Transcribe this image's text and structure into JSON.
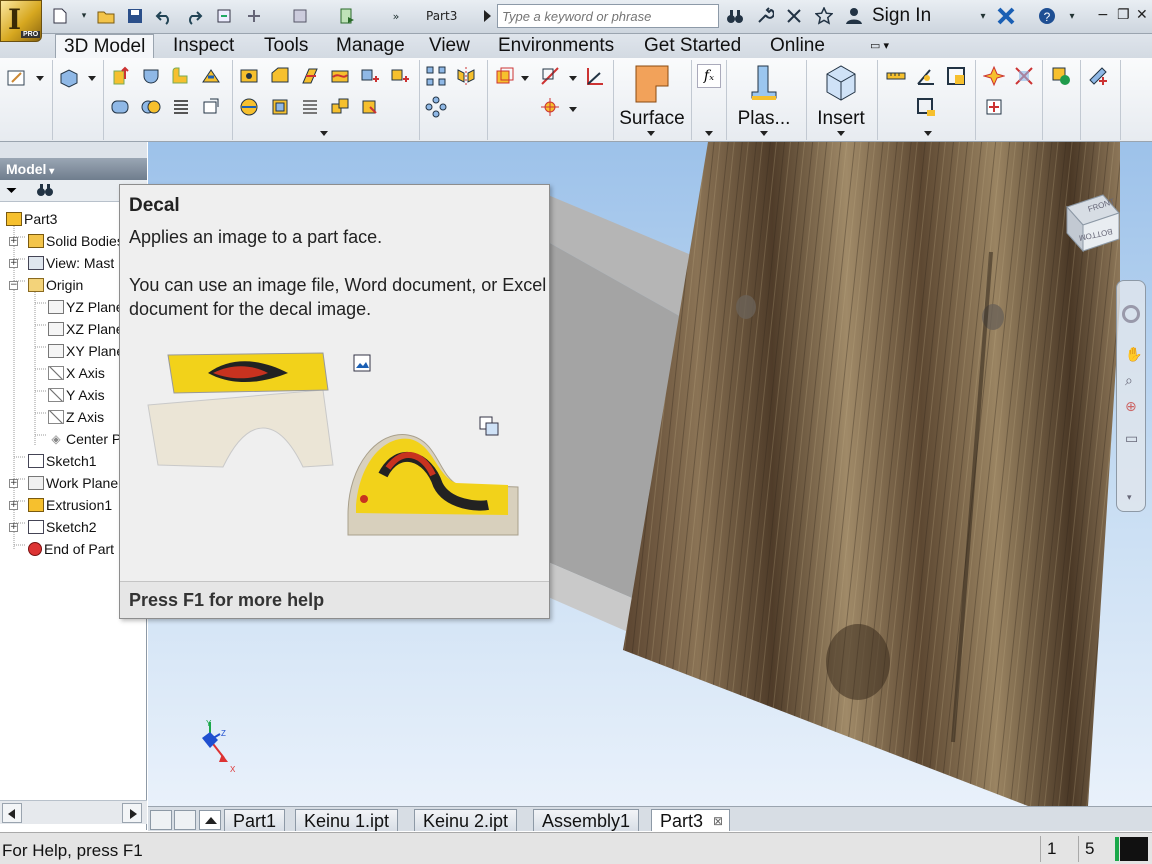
{
  "app": {
    "document_title": "Part3",
    "search_placeholder": "Type a keyword or phrase",
    "sign_in": "Sign In",
    "logo_badge": "PRO"
  },
  "ribbon_tabs": [
    "3D Model",
    "Inspect",
    "Tools",
    "Manage",
    "View",
    "Environments",
    "Get Started",
    "Online"
  ],
  "ribbon": {
    "surface_label": "Surface",
    "plastic_label": "Plas...",
    "insert_label": "Insert"
  },
  "browser": {
    "header": "Model",
    "tree": [
      {
        "label": "Part3"
      },
      {
        "label": "Solid Bodies"
      },
      {
        "label": "View: Mast"
      },
      {
        "label": "Origin"
      },
      {
        "label": "YZ Plane"
      },
      {
        "label": "XZ Plane"
      },
      {
        "label": "XY Plane"
      },
      {
        "label": "X Axis"
      },
      {
        "label": "Y Axis"
      },
      {
        "label": "Z Axis"
      },
      {
        "label": "Center P"
      },
      {
        "label": "Sketch1"
      },
      {
        "label": "Work Plane"
      },
      {
        "label": "Extrusion1"
      },
      {
        "label": "Sketch2"
      },
      {
        "label": "End of Part"
      }
    ]
  },
  "tooltip": {
    "title": "Decal",
    "description": "Applies an image to a part face.",
    "body": "You can use an image file, Word document, or Excel document for the decal image.",
    "footer": "Press F1 for more help"
  },
  "viewcube": {
    "face_front": "FRONT",
    "face_bottom": "BOTTOM"
  },
  "axes": {
    "x": "X",
    "y": "Y",
    "z": "Z"
  },
  "document_tabs": [
    "Part1",
    "Keinu 1.ipt",
    "Keinu 2.ipt",
    "Assembly1",
    "Part3"
  ],
  "status": {
    "help_text": "For Help, press F1",
    "count1": "1",
    "count2": "5"
  },
  "colors": {
    "accent": "#2b5f9e",
    "wood_dark": "#4a3826",
    "wood_light": "#9a8462",
    "sky_top": "#9dc2ea",
    "decal_yellow": "#f2d21a"
  }
}
